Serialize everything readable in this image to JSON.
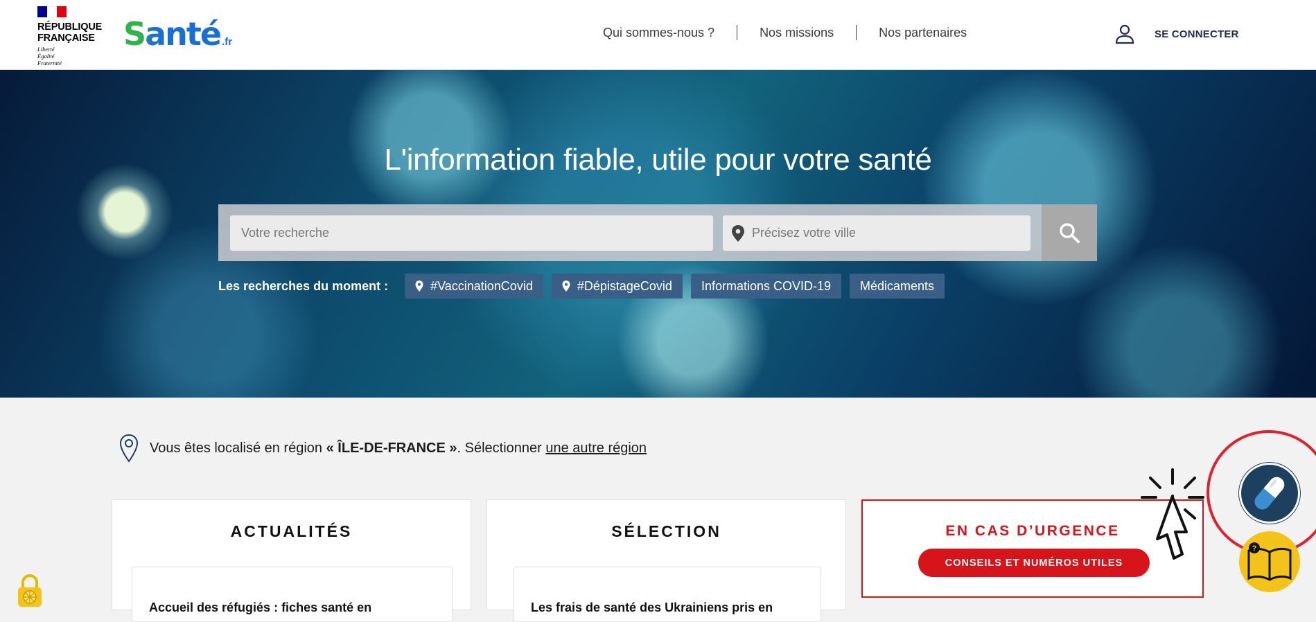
{
  "header": {
    "rf_name_line1": "RÉPUBLIQUE",
    "rf_name_line2": "FRANÇAISE",
    "rf_motto_1": "Liberté",
    "rf_motto_2": "Égalité",
    "rf_motto_3": "Fraternité",
    "logo_word": "Santé",
    "logo_tld": ".fr",
    "nav": [
      "Qui sommes-nous ?",
      "Nos missions",
      "Nos partenaires"
    ],
    "login_label": "SE CONNECTER"
  },
  "hero": {
    "title": "L'information fiable, utile pour votre santé",
    "search_placeholder": "Votre recherche",
    "city_placeholder": "Précisez votre ville",
    "trending_label": "Les recherches du moment :",
    "tags": [
      "#VaccinationCovid",
      "#DépistageCovid",
      "Informations COVID-19",
      "Médicaments"
    ]
  },
  "location": {
    "prefix": "Vous êtes localisé en région ",
    "region": "« ÎLE-DE-FRANCE »",
    "middle": ". Sélectionner ",
    "link": "une autre région"
  },
  "cards": {
    "news_title": "ACTUALITÉS",
    "news_peek": "Accueil des réfugiés : fiches santé en",
    "selection_title": "SÉLECTION",
    "selection_peek": "Les frais de santé des Ukrainiens pris en",
    "urgent_title": "EN CAS D’URGENCE",
    "urgent_button": "CONSEILS ET NUMÉROS UTILES"
  },
  "colors": {
    "accent_red": "#d8141b",
    "tag_blue": "#3a5f86",
    "brand_blue": "#1a6fd6",
    "brand_green": "#2fb34a"
  },
  "icons": [
    "user-icon",
    "map-pin-icon",
    "search-icon",
    "location-pin-icon",
    "pill-icon",
    "book-icon",
    "lock-icon",
    "click-cursor-icon"
  ]
}
